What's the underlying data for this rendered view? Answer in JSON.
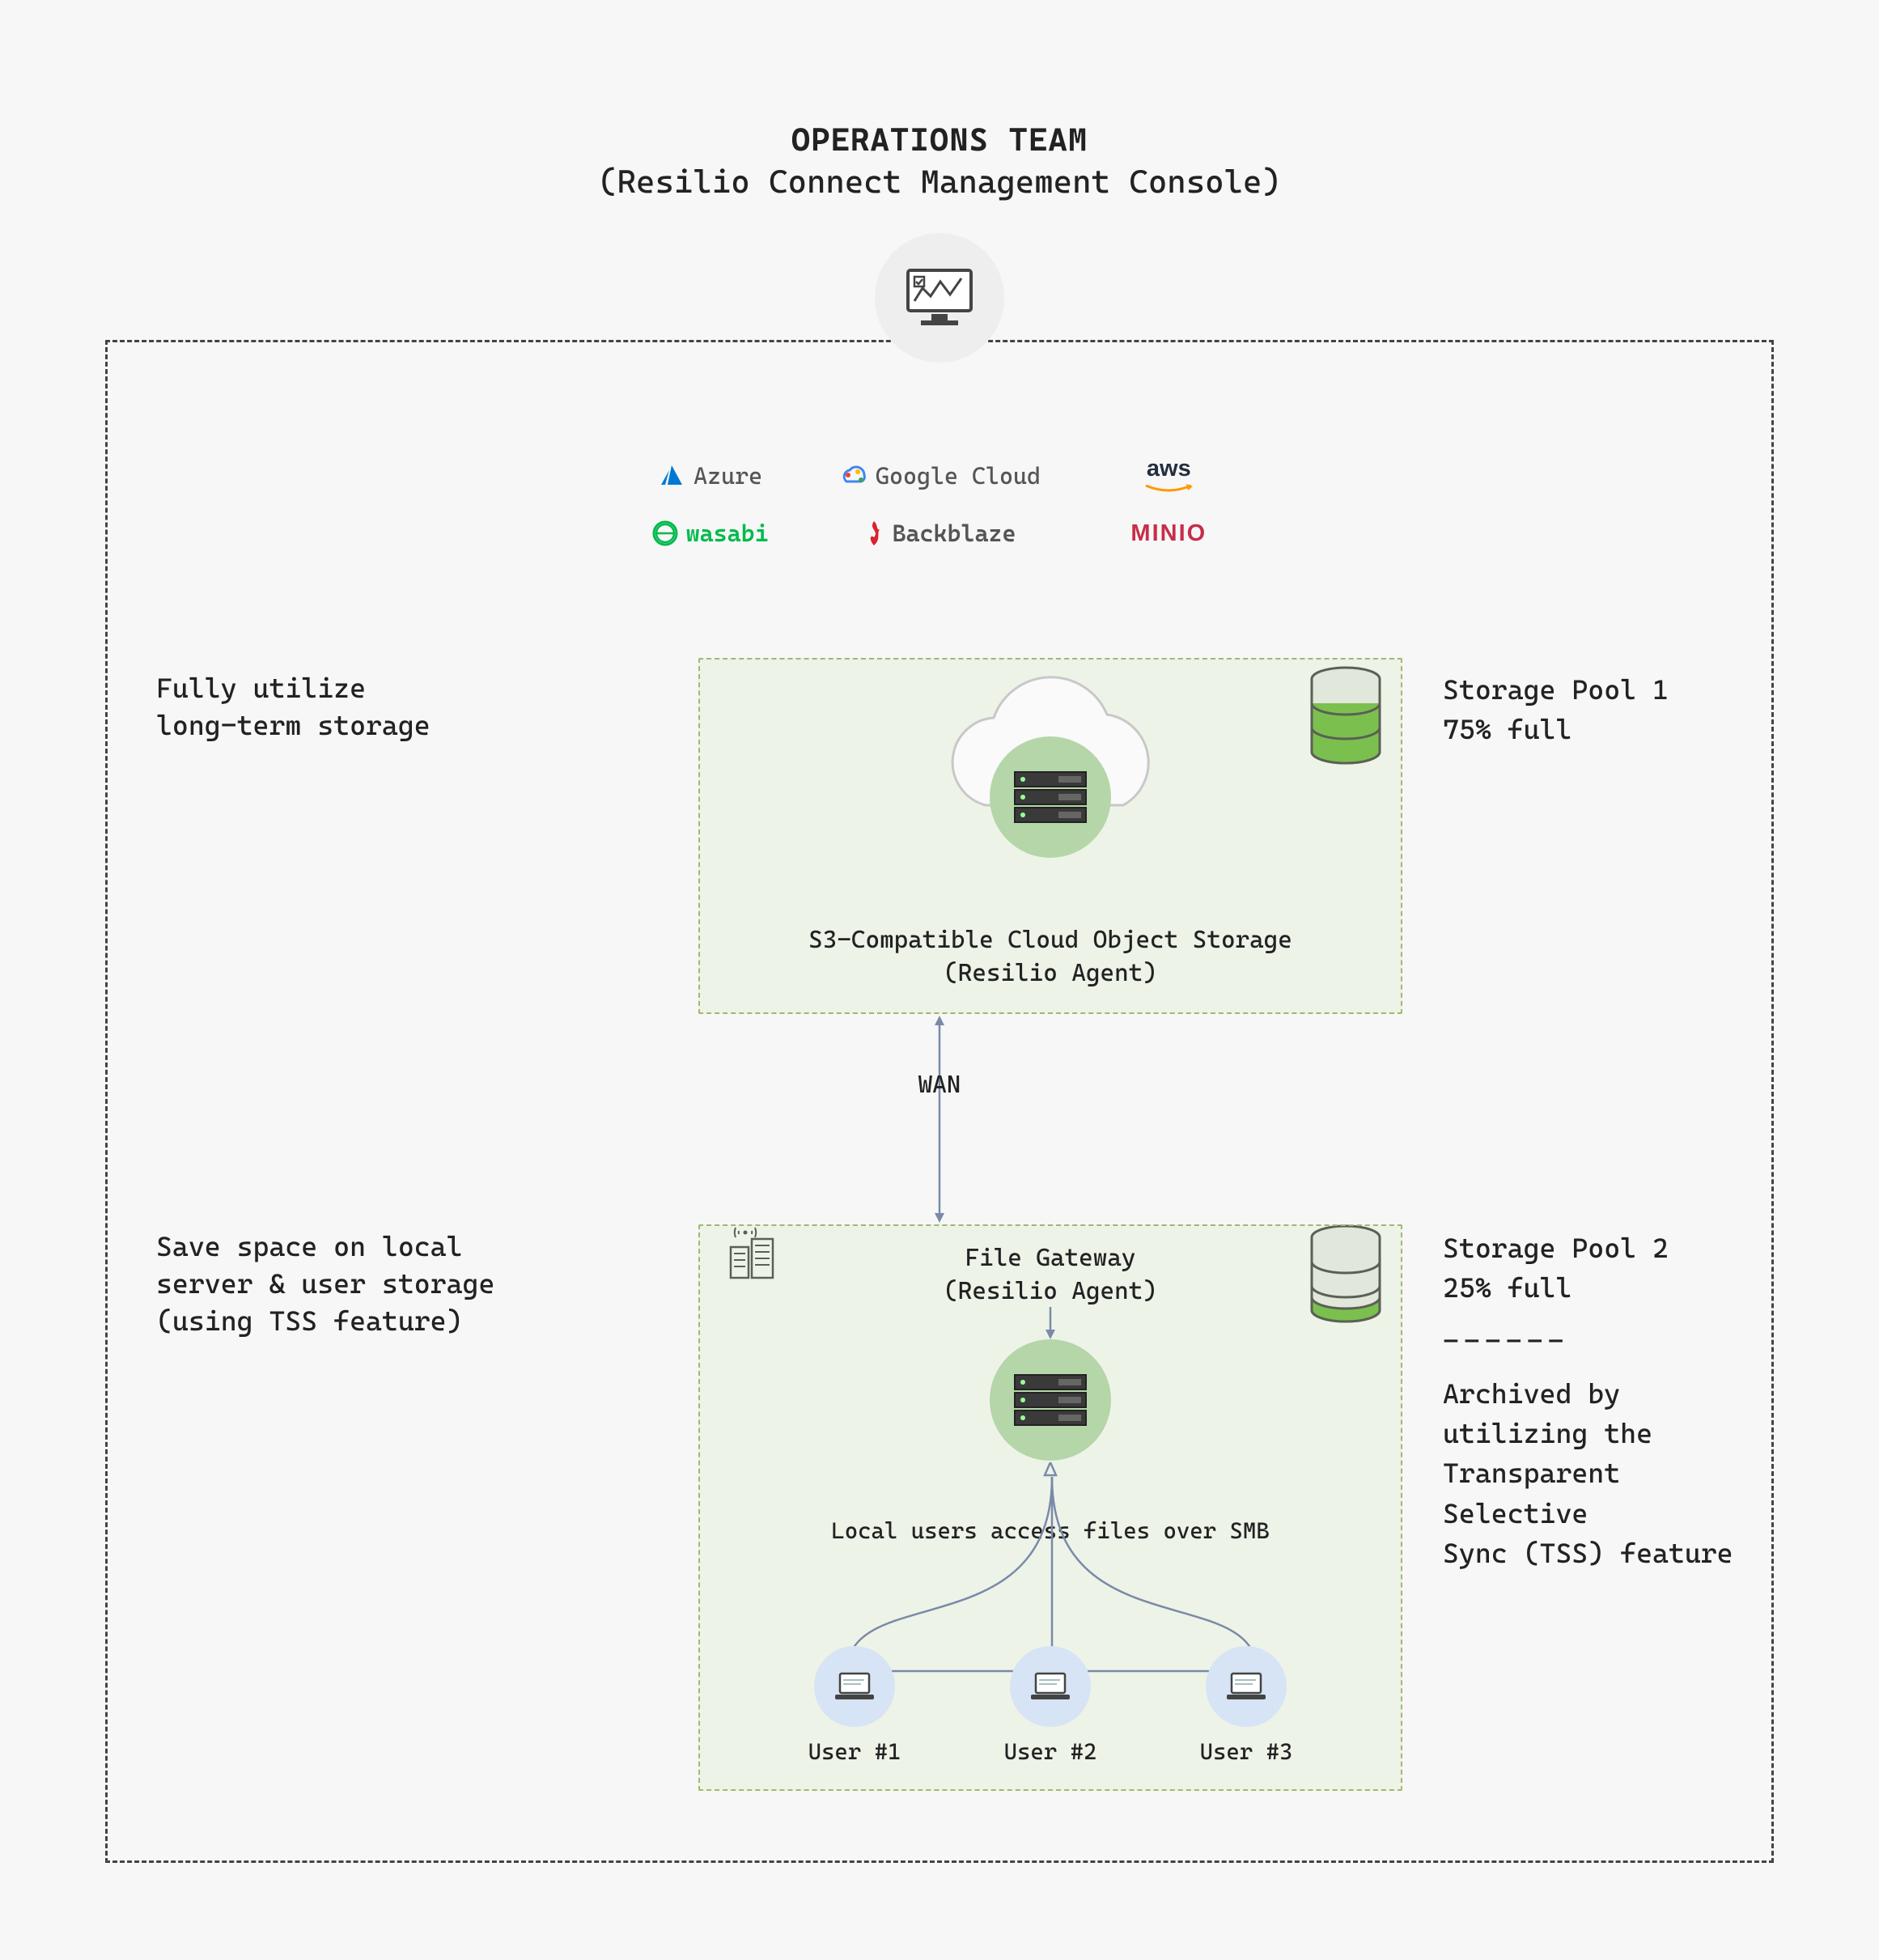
{
  "title": "OPERATIONS TEAM",
  "subtitle": "(Resilio Connect Management Console)",
  "cloud_providers": {
    "row1": [
      "Azure",
      "Google Cloud",
      "aws"
    ],
    "row2": [
      "wasabi",
      "Backblaze",
      "MINIO"
    ]
  },
  "left_labels": {
    "top": "Fully utilize\nlong-term storage",
    "bottom": "Save space on local\nserver & user storage\n(using TSS feature)"
  },
  "right_labels": {
    "pool1_name": "Storage Pool 1",
    "pool1_full": "75% full",
    "pool2_name": "Storage Pool 2",
    "pool2_full": "25% full",
    "divider": "------",
    "tss_note": "Archived by utilizing the\nTransparent Selective\nSync (TSS) feature"
  },
  "cloud_box": {
    "line1": "S3-Compatible Cloud Object Storage",
    "line2": "(Resilio Agent)"
  },
  "wan_label": "WAN",
  "gateway": {
    "line1": "File Gateway",
    "line2": "(Resilio Agent)"
  },
  "smb_label": "Local users access files over SMB",
  "users": [
    "User #1",
    "User #2",
    "User #3"
  ],
  "storage_pools": {
    "pool1_fill_percent": 75,
    "pool2_fill_percent": 25
  },
  "icons": {
    "console": "monitor-chart-icon",
    "server": "server-icon",
    "laptop": "laptop-icon",
    "cloud": "cloud-icon",
    "database": "database-icon",
    "building": "building-antenna-icon"
  }
}
